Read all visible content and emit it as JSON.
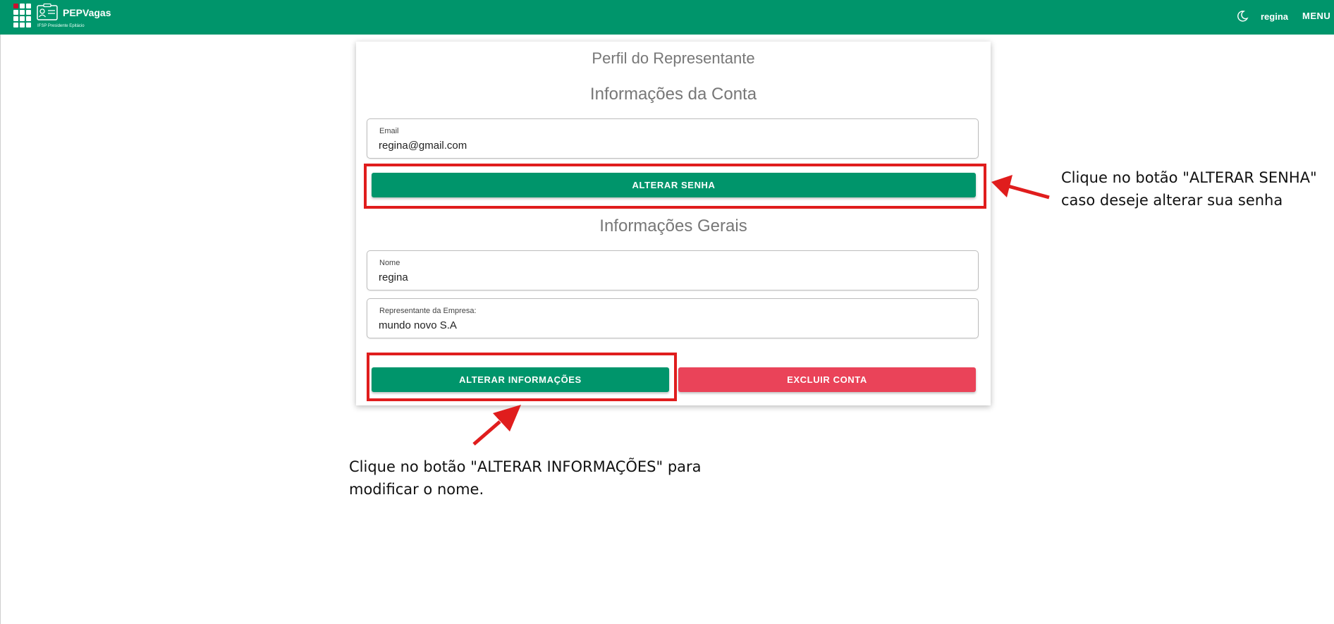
{
  "header": {
    "brand": "PEPVagas",
    "subtitle": "IFSP Presidente Epitácio",
    "user": "regina",
    "menu_label": "MENU",
    "accent_color": "#00956b",
    "icons": [
      "ifsp-logo-icon",
      "id-badge-icon",
      "moon-icon"
    ]
  },
  "profile": {
    "title": "Perfil do Representante",
    "account_section": "Informações da Conta",
    "email_label": "Email",
    "email_value": "regina@gmail.com",
    "change_password_label": "ALTERAR SENHA",
    "general_section": "Informações Gerais",
    "name_label": "Nome",
    "name_value": "regina",
    "company_label": "Representante da Empresa:",
    "company_value": "mundo novo S.A",
    "update_info_label": "ALTERAR INFORMAÇÕES",
    "delete_account_label": "EXCLUIR CONTA",
    "delete_color": "#ea4359"
  },
  "annotations": {
    "password_line1": "Clique no botão \"ALTERAR SENHA\"",
    "password_line2": "caso deseje alterar sua senha",
    "info_line1": "Clique no botão \"ALTERAR INFORMAÇÕES\" para",
    "info_line2": "modificar o nome.",
    "highlight_color": "#e01d1d"
  }
}
